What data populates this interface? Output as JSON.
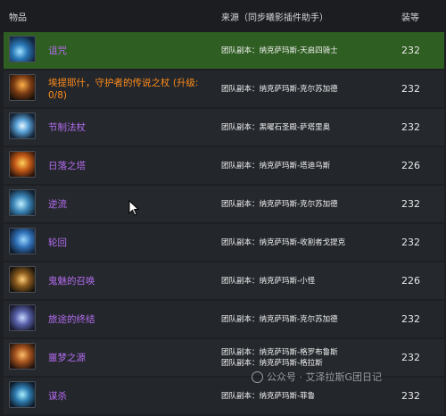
{
  "header": {
    "item_col": "物品",
    "source_col": "来源（同步曦影插件助手）",
    "ilvl_col": "装等"
  },
  "rows": [
    {
      "name": "诅咒",
      "color": "#b46cf0",
      "source": [
        "团队副本：纳克萨玛斯-天启四骑士"
      ],
      "ilvl": "232",
      "icon": "dagger-icon",
      "highlight": true
    },
    {
      "name": "埃提耶什，守护者的传说之杖 (升级: 0/8)",
      "color": "#ff8c1a",
      "source": [
        "团队副本：纳克萨玛斯-克尔苏加德"
      ],
      "ilvl": "232",
      "icon": "staff-icon"
    },
    {
      "name": "节制法杖",
      "color": "#b46cf0",
      "source": [
        "团队副本：黑曜石圣殿-萨塔里奥"
      ],
      "ilvl": "232",
      "icon": "wand-icon"
    },
    {
      "name": "日落之塔",
      "color": "#b46cf0",
      "source": [
        "团队副本：纳克萨玛斯-塔迪乌斯"
      ],
      "ilvl": "226",
      "icon": "tower-icon"
    },
    {
      "name": "逆流",
      "color": "#b46cf0",
      "source": [
        "团队副本：纳克萨玛斯-克尔苏加德"
      ],
      "ilvl": "232",
      "icon": "blade-icon"
    },
    {
      "name": "轮回",
      "color": "#b46cf0",
      "source": [
        "团队副本：纳克萨玛斯-收割者戈提克"
      ],
      "ilvl": "232",
      "icon": "orb-icon"
    },
    {
      "name": "鬼魅的召唤",
      "color": "#b46cf0",
      "source": [
        "团队副本：纳克萨玛斯-小怪"
      ],
      "ilvl": "226",
      "icon": "sword-icon"
    },
    {
      "name": "旅途的终结",
      "color": "#b46cf0",
      "source": [
        "团队副本：纳克萨玛斯-克尔苏加德"
      ],
      "ilvl": "232",
      "icon": "crossbow-icon"
    },
    {
      "name": "噩梦之源",
      "color": "#b46cf0",
      "source": [
        "团队副本：纳克萨玛斯-格罗布鲁斯",
        "团队副本：纳克萨玛斯-格拉斯"
      ],
      "ilvl": "232",
      "icon": "mace-icon"
    },
    {
      "name": "谋杀",
      "color": "#b46cf0",
      "source": [
        "团队副本：纳克萨玛斯-菲鲁"
      ],
      "ilvl": "232",
      "icon": "knife-icon"
    }
  ],
  "watermark": "公众号 · 艾泽拉斯G团日记"
}
